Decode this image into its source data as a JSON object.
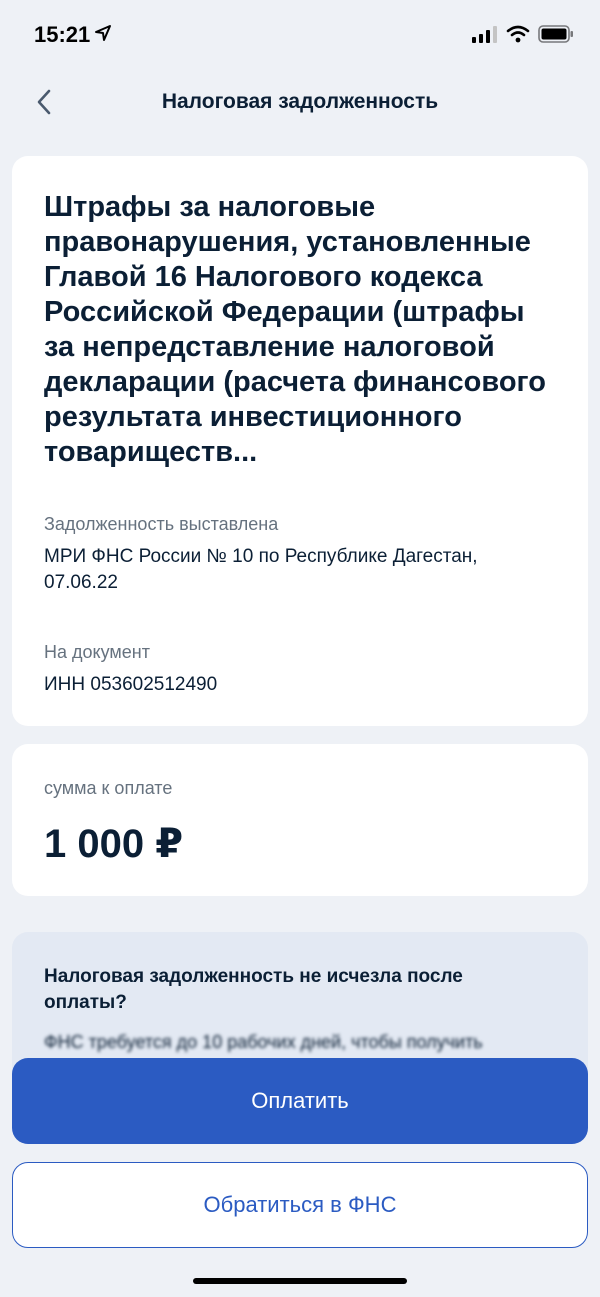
{
  "status_bar": {
    "time": "15:21",
    "icons": [
      "location-arrow-icon",
      "cellular-signal-icon",
      "wifi-icon",
      "battery-icon"
    ]
  },
  "nav": {
    "back_icon": "chevron-left-icon",
    "title": "Налоговая задолженность"
  },
  "debt": {
    "title": "Штрафы за налоговые правонарушения, установленные Главой 16 Налогового кодекса Российской Федерации (штрафы за непредставление налоговой декларации (расчета финансового результата инвестиционного товариществ...",
    "issued_label": "Задолженность выставлена",
    "issued_value": "МРИ ФНС России № 10 по Республике Дагестан, 07.06.22",
    "document_label": "На документ",
    "document_value": "ИНН 053602512490"
  },
  "payment": {
    "amount_label": "сумма к оплате",
    "amount_value": "1 000 ₽"
  },
  "info": {
    "title": "Налоговая задолженность не исчезла после оплаты?",
    "text": "ФНС требуется до 10 рабочих дней, чтобы получить"
  },
  "actions": {
    "pay_label": "Оплатить",
    "contact_label": "Обратиться в ФНС"
  },
  "colors": {
    "accent": "#2b5bc2",
    "background": "#eef1f6",
    "text_primary": "#0b1f35",
    "text_secondary": "#66727f",
    "info_background": "#e3e9f3"
  }
}
